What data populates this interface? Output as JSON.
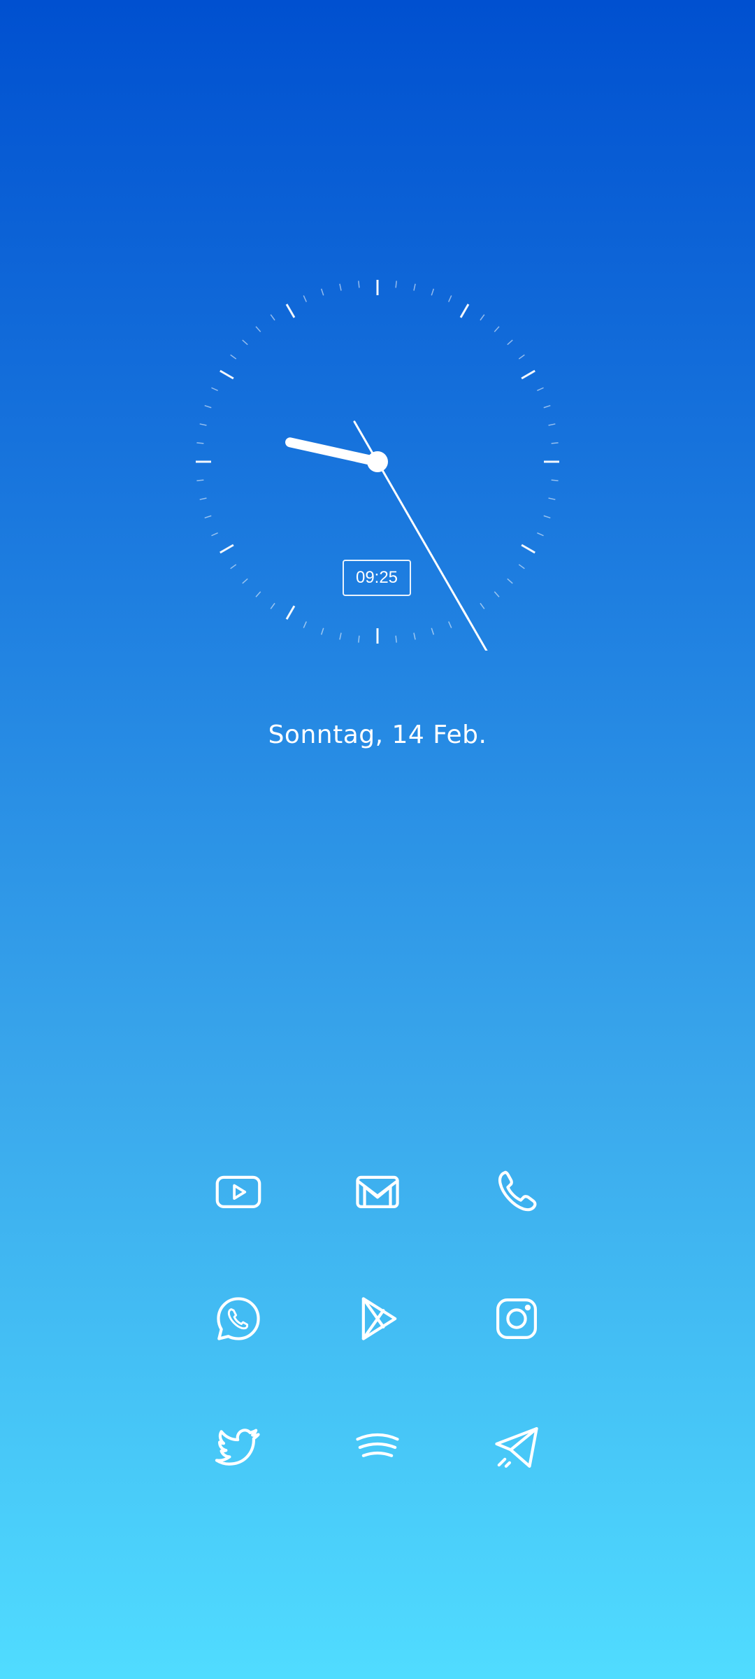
{
  "lockscreen": {
    "digital_time": "09:25",
    "date": "Sonntag, 14 Feb."
  },
  "clock": {
    "hour": 9,
    "minute": 25,
    "second": 25
  },
  "apps": [
    {
      "name": "youtube",
      "icon": "youtube-icon"
    },
    {
      "name": "gmail",
      "icon": "mail-icon"
    },
    {
      "name": "phone",
      "icon": "phone-icon"
    },
    {
      "name": "whatsapp",
      "icon": "whatsapp-icon"
    },
    {
      "name": "play-store",
      "icon": "play-store-icon"
    },
    {
      "name": "instagram",
      "icon": "instagram-icon"
    },
    {
      "name": "twitter",
      "icon": "twitter-icon"
    },
    {
      "name": "spotify",
      "icon": "spotify-icon"
    },
    {
      "name": "telegram",
      "icon": "telegram-icon"
    }
  ],
  "colors": {
    "gradient_top": "#0050d0",
    "gradient_bottom": "#50dcff",
    "foreground": "#ffffff"
  }
}
